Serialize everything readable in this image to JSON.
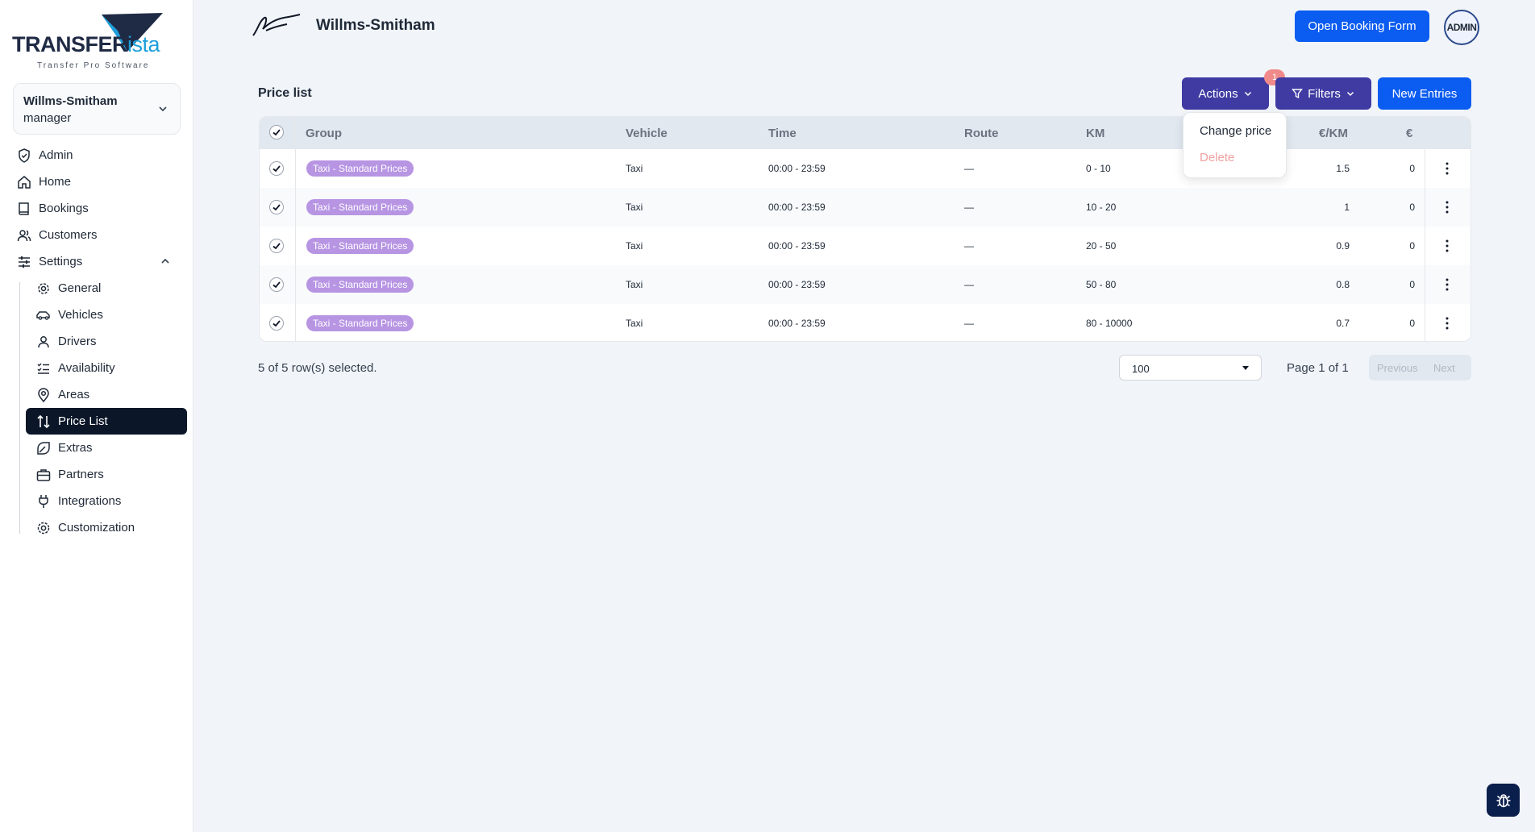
{
  "brand": {
    "logo_word": "TRANSFER",
    "logo_word_accent": "ista",
    "logo_tagline": "Transfer Pro Software"
  },
  "account": {
    "name": "Willms-Smitham",
    "role": "manager"
  },
  "sidebar": {
    "items": [
      {
        "label": "Admin",
        "icon": "shield-icon"
      },
      {
        "label": "Home",
        "icon": "home-icon"
      },
      {
        "label": "Bookings",
        "icon": "book-icon"
      },
      {
        "label": "Customers",
        "icon": "users-icon"
      },
      {
        "label": "Settings",
        "icon": "sliders-icon"
      }
    ],
    "settings_items": [
      {
        "label": "General",
        "icon": "cog-icon"
      },
      {
        "label": "Vehicles",
        "icon": "car-icon"
      },
      {
        "label": "Drivers",
        "icon": "user-icon"
      },
      {
        "label": "Availability",
        "icon": "list-check-icon"
      },
      {
        "label": "Areas",
        "icon": "map-pin-icon"
      },
      {
        "label": "Price List",
        "icon": "arrows-up-down-icon",
        "active": true
      },
      {
        "label": "Extras",
        "icon": "tag-icon"
      },
      {
        "label": "Partners",
        "icon": "briefcase-icon"
      },
      {
        "label": "Integrations",
        "icon": "plug-icon"
      },
      {
        "label": "Customization",
        "icon": "gear-icon"
      }
    ]
  },
  "header": {
    "company": "Willms-Smitham",
    "booking_button": "Open Booking Form",
    "avatar_label": "ADMIN"
  },
  "page": {
    "title": "Price list",
    "actions_label": "Actions",
    "filters_label": "Filters",
    "new_label": "New Entries",
    "filter_badge": "1",
    "actions_menu": [
      "Change price",
      "Delete"
    ]
  },
  "table": {
    "columns": [
      "Group",
      "Vehicle",
      "Time",
      "Route",
      "KM",
      "€/KM",
      "€"
    ],
    "rows": [
      {
        "group": "Taxi - Standard Prices",
        "vehicle": "Taxi",
        "time": "00:00 - 23:59",
        "route": "—",
        "km": "0 - 10",
        "per_km": "1.5",
        "fixed": "0"
      },
      {
        "group": "Taxi - Standard Prices",
        "vehicle": "Taxi",
        "time": "00:00 - 23:59",
        "route": "—",
        "km": "10 - 20",
        "per_km": "1",
        "fixed": "0"
      },
      {
        "group": "Taxi - Standard Prices",
        "vehicle": "Taxi",
        "time": "00:00 - 23:59",
        "route": "—",
        "km": "20 - 50",
        "per_km": "0.9",
        "fixed": "0"
      },
      {
        "group": "Taxi - Standard Prices",
        "vehicle": "Taxi",
        "time": "00:00 - 23:59",
        "route": "—",
        "km": "50 - 80",
        "per_km": "0.8",
        "fixed": "0"
      },
      {
        "group": "Taxi - Standard Prices",
        "vehicle": "Taxi",
        "time": "00:00 - 23:59",
        "route": "—",
        "km": "80 - 10000",
        "per_km": "0.7",
        "fixed": "0"
      }
    ]
  },
  "footer": {
    "selection": "5 of 5 row(s) selected.",
    "page_size": "100",
    "page_info": "Page 1 of 1",
    "prev": "Previous",
    "next": "Next"
  },
  "colors": {
    "primary": "#0b5cf0",
    "action": "#3f3ba2",
    "active_nav": "#0b1628",
    "tag": "#b795e3",
    "danger": "#f0a0a0"
  }
}
